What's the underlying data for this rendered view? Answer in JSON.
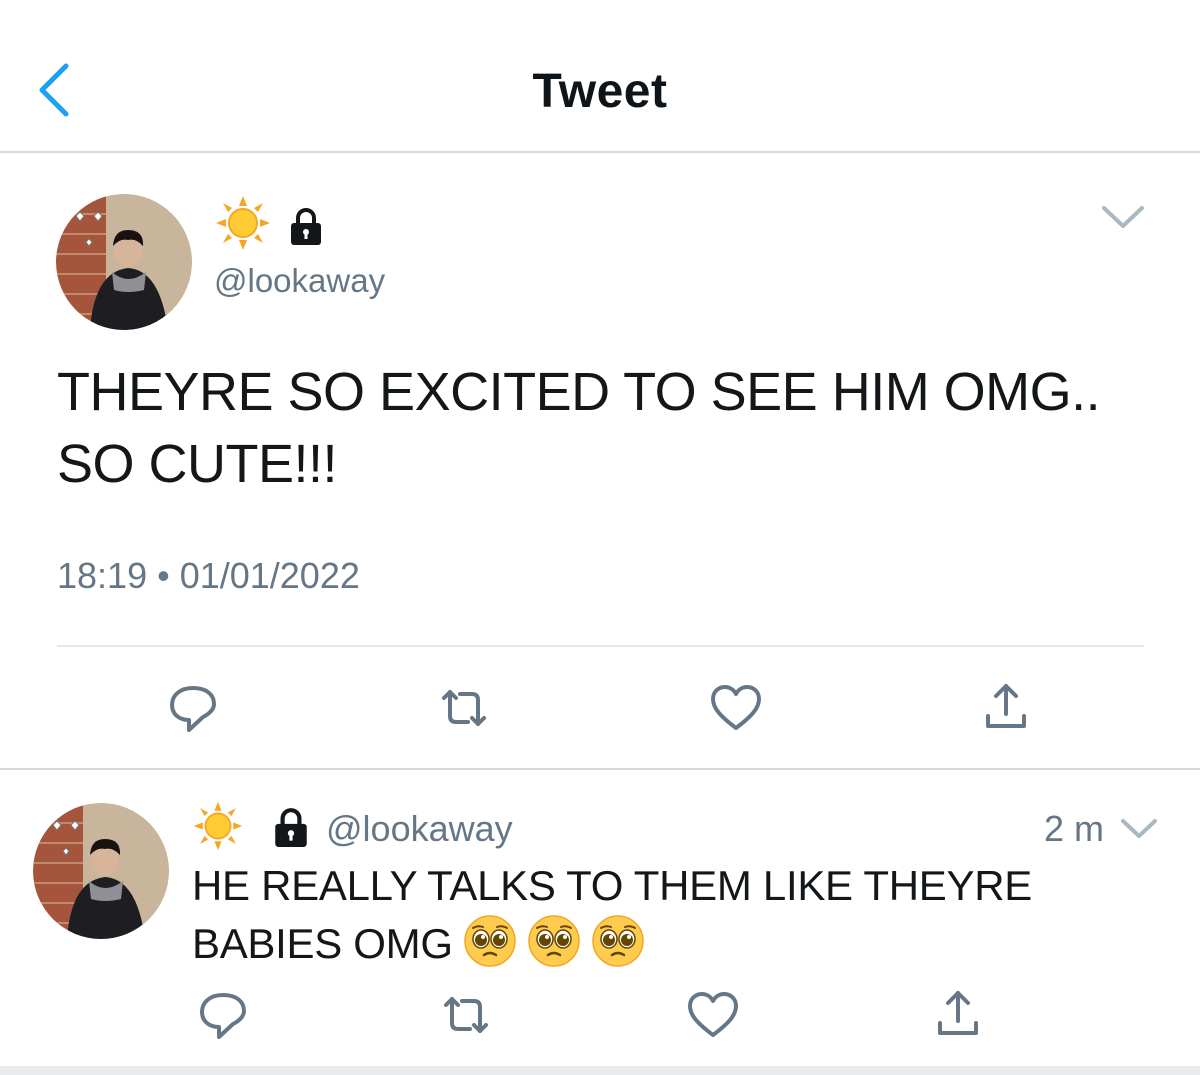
{
  "header": {
    "title": "Tweet",
    "back_icon": "chevron-left-icon"
  },
  "main_tweet": {
    "display_name_icons": [
      "sun-emoji-icon",
      "lock-icon"
    ],
    "handle": "@lookaway",
    "text": "THEYRE SO EXCITED TO SEE HIM OMG.. SO CUTE!!!",
    "timestamp": "18:19 • 01/01/2022",
    "actions": [
      "reply-icon",
      "retweet-icon",
      "like-icon",
      "share-icon"
    ]
  },
  "reply_tweet": {
    "display_name_icons": [
      "sun-emoji-icon",
      "lock-icon"
    ],
    "handle": "@lookaway",
    "time": "2 m",
    "text": "HE REALLY TALKS TO THEM LIKE THEYRE BABIES OMG",
    "emojis": [
      "pleading-face-emoji",
      "pleading-face-emoji",
      "pleading-face-emoji"
    ],
    "actions": [
      "reply-icon",
      "retweet-icon",
      "like-icon",
      "share-icon"
    ]
  },
  "colors": {
    "accent": "#1da1f2",
    "text_primary": "#14171a",
    "text_secondary": "#657786",
    "icon_gray": "#657786",
    "divider": "#e1e8ed"
  }
}
